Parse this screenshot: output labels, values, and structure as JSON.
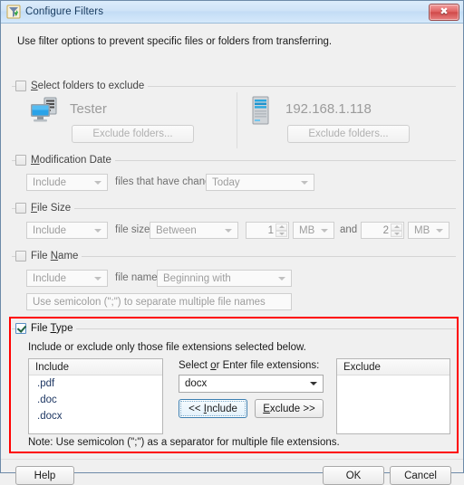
{
  "window": {
    "title": "Configure Filters",
    "title_icon": "filter-app-icon",
    "close_label": "✖"
  },
  "intro": "Use filter options to prevent specific files or folders from transferring.",
  "groups": {
    "folders": {
      "title_pre": "",
      "title_accel": "S",
      "title_post": "elect folders to exclude",
      "checked": false,
      "source": {
        "icon": "computer-icon",
        "name": "Tester",
        "button": "Exclude folders..."
      },
      "target": {
        "icon": "server-icon",
        "name": "192.168.1.118",
        "button": "Exclude folders..."
      }
    },
    "moddate": {
      "title_accel": "M",
      "title_post": "odification Date",
      "checked": false,
      "mode": "Include",
      "middle_label": "files that have changed",
      "period": "Today"
    },
    "filesize": {
      "title_accel": "F",
      "title_post": "ile Size",
      "checked": false,
      "mode": "Include",
      "middle_label": "file size",
      "operator": "Between",
      "value1": "1",
      "unit1": "MB",
      "conjunction": "and",
      "value2": "2",
      "unit2": "MB"
    },
    "filename": {
      "title_pre": "File ",
      "title_accel": "N",
      "title_post": "ame",
      "checked": false,
      "mode": "Include",
      "middle_label": "file names",
      "match": "Beginning with",
      "names_placeholder": "Use semicolon (\";\") to separate multiple file names"
    },
    "filetype": {
      "title_pre": "File ",
      "title_accel": "T",
      "title_post": "ype",
      "checked": true,
      "description": "Include or exclude only those file extensions selected below.",
      "include_list": {
        "header": "Include",
        "items": [
          ".pdf",
          ".doc",
          ".docx"
        ]
      },
      "exclude_list": {
        "header": "Exclude",
        "items": []
      },
      "select_label_pre": "Select ",
      "select_label_accel": "o",
      "select_label_post": "r Enter file extensions:",
      "extension_value": "docx",
      "include_button_pre": "<< ",
      "include_button_accel": "I",
      "include_button_post": "nclude",
      "exclude_button_accel": "E",
      "exclude_button_post": "xclude >>",
      "note": "Note: Use semicolon (\";\") as a separator for multiple file extensions.",
      "highlight_color": "#ff0000"
    }
  },
  "footer": {
    "help": "Help",
    "ok": "OK",
    "cancel": "Cancel"
  }
}
